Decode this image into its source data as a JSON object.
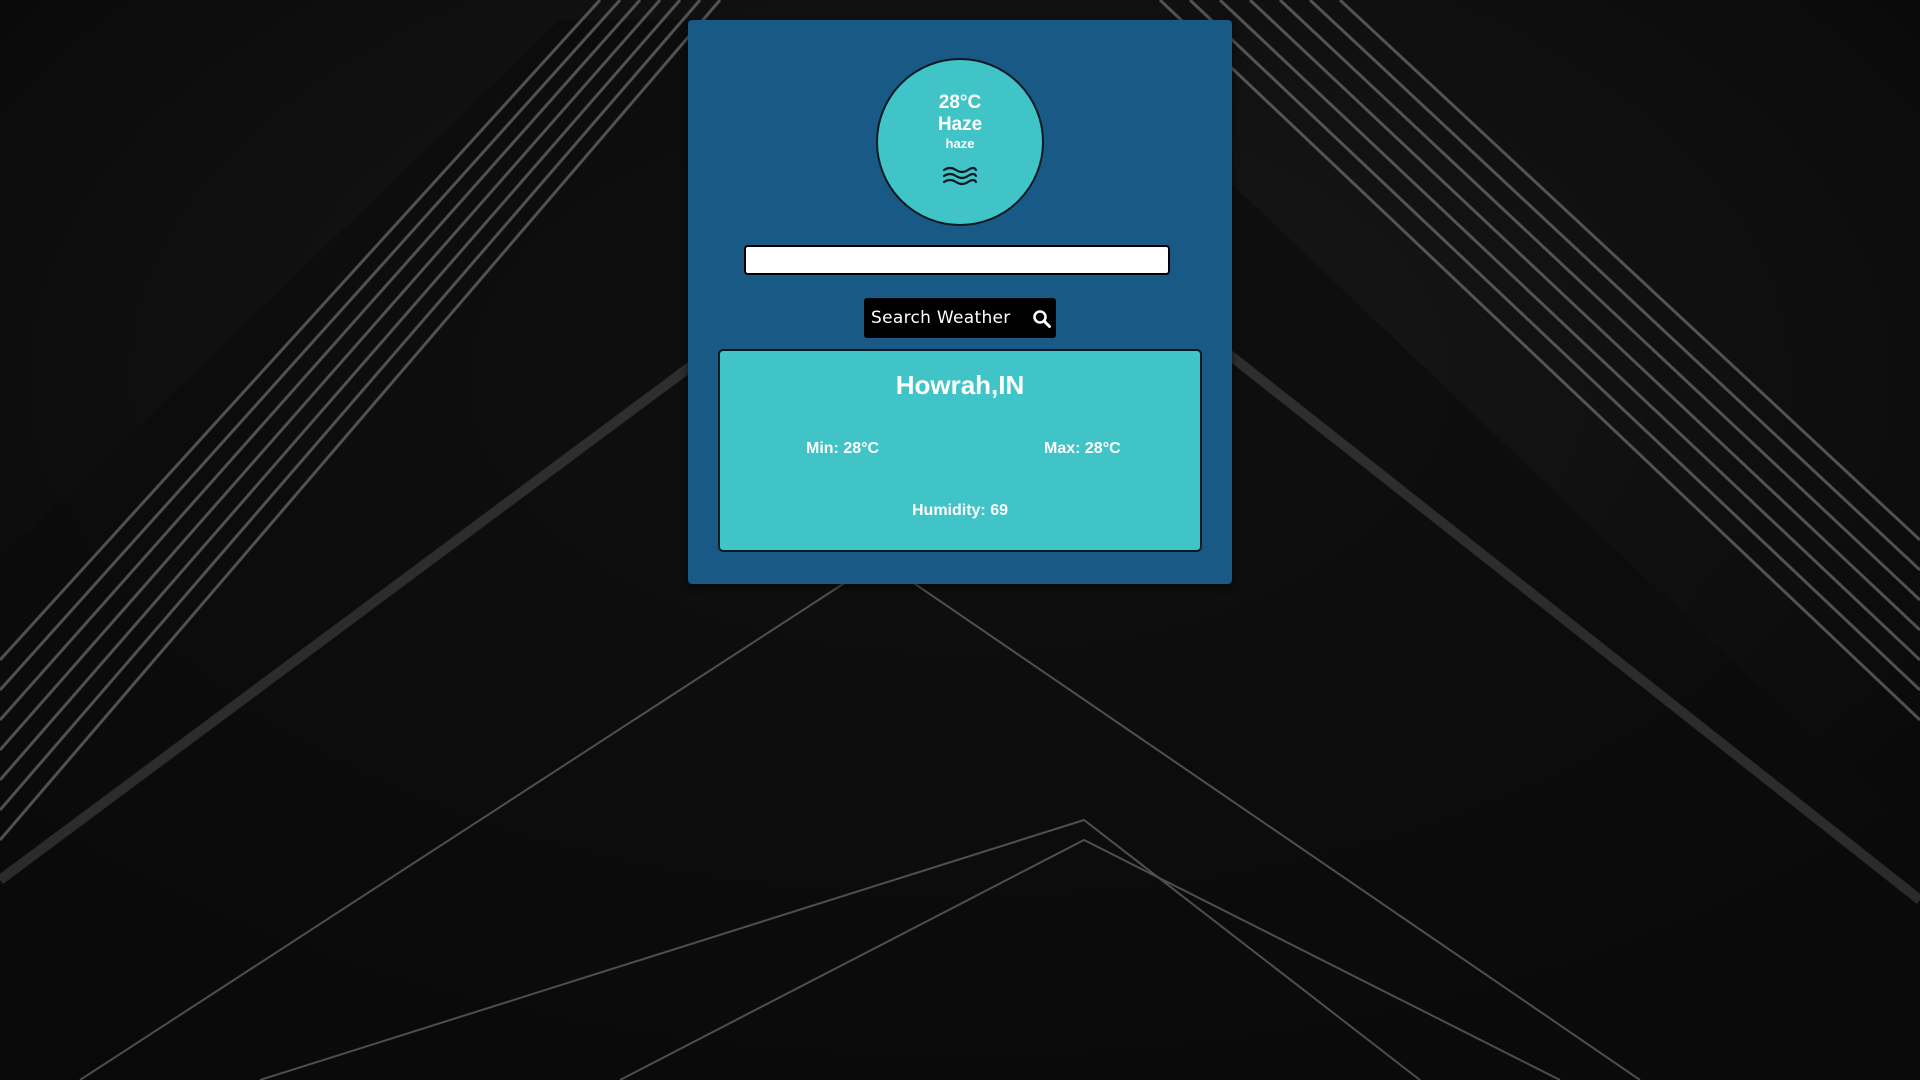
{
  "colors": {
    "card_background": "#185a85",
    "accent_teal": "#40c4c7",
    "button_background": "#000000",
    "text": "#ffffff"
  },
  "current": {
    "temperature": "28°C",
    "main": "Haze",
    "description": "haze",
    "icon": "haze-icon"
  },
  "search": {
    "value": "",
    "placeholder": "",
    "button_label": "Search Weather",
    "button_icon": "search-icon"
  },
  "details": {
    "location": "Howrah,IN",
    "min": "Min: 28°C",
    "max": "Max: 28°C",
    "humidity": "Humidity:  69"
  }
}
